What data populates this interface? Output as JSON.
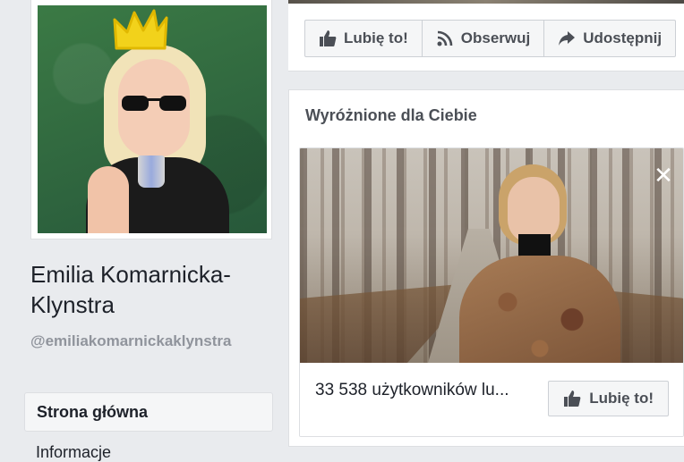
{
  "profile": {
    "name": "Emilia Komarnicka-Klynstra",
    "handle": "@emiliakomarnickaklynstra"
  },
  "nav": {
    "items": [
      {
        "label": "Strona główna",
        "active": true
      },
      {
        "label": "Informacje",
        "active": false
      }
    ]
  },
  "actions": {
    "like_label": "Lubię to!",
    "follow_label": "Obserwuj",
    "share_label": "Udostępnij"
  },
  "featured": {
    "title": "Wyróżnione dla Ciebie",
    "likes_text": "33 538 użytkowników lu...",
    "like_button_label": "Lubię to!",
    "close_symbol": "✕"
  },
  "icons": {
    "like": "thumbs-up-icon",
    "follow": "rss-icon",
    "share": "share-arrow-icon",
    "close": "close-icon"
  },
  "colors": {
    "page_bg": "#e9ebee",
    "button_text": "#4b4f56",
    "muted_text": "#90949c"
  }
}
